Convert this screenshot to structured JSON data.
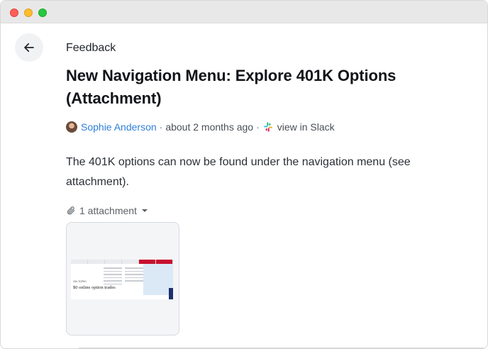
{
  "category": "Feedback",
  "title": "New Navigation Menu: Explore 401K Options (Attachment)",
  "meta": {
    "author": "Sophie Anderson",
    "separator": "·",
    "time": "about 2 months ago",
    "slack_link": "view in Slack"
  },
  "body": "The 401K options can now be found under the navigation menu (see attachment).",
  "attachments": {
    "toggle_label": "1 attachment",
    "thumbnail": {
      "big_text": "$0 online option trades",
      "small_text": "ON TOPIC"
    }
  },
  "colors": {
    "link": "#2f7fd8",
    "accent_red": "#c8102e"
  }
}
